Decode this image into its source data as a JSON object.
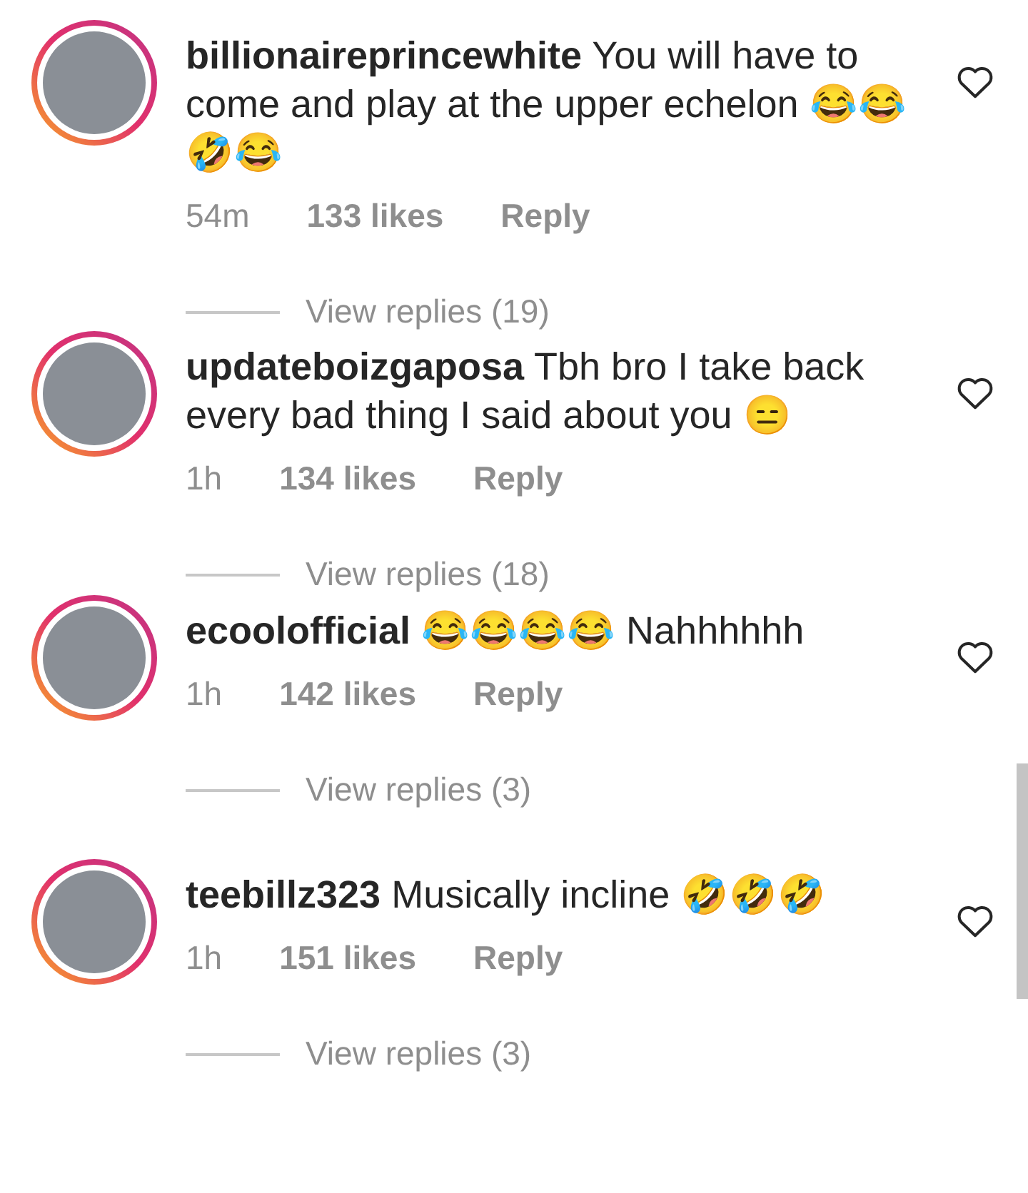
{
  "comments": [
    {
      "username": "billionaireprincewhite",
      "text": "You will have to come and play at the upper echelon 😂😂🤣😂",
      "time": "54m",
      "likes": "133 likes",
      "reply": "Reply",
      "view_replies": "View replies (19)",
      "liked": false
    },
    {
      "username": "updateboizgaposa",
      "text": "Tbh bro I take back every bad thing I said about you 😑",
      "time": "1h",
      "likes": "134 likes",
      "reply": "Reply",
      "view_replies": "View replies (18)",
      "liked": false
    },
    {
      "username": "ecoolofficial",
      "text": "😂😂😂😂 Nahhhhhh",
      "time": "1h",
      "likes": "142 likes",
      "reply": "Reply",
      "view_replies": "View replies (3)",
      "liked": false
    },
    {
      "username": "teebillz323",
      "text": "Musically incline 🤣🤣🤣",
      "time": "1h",
      "likes": "151 likes",
      "reply": "Reply",
      "view_replies": "View replies (3)",
      "liked": false
    }
  ]
}
